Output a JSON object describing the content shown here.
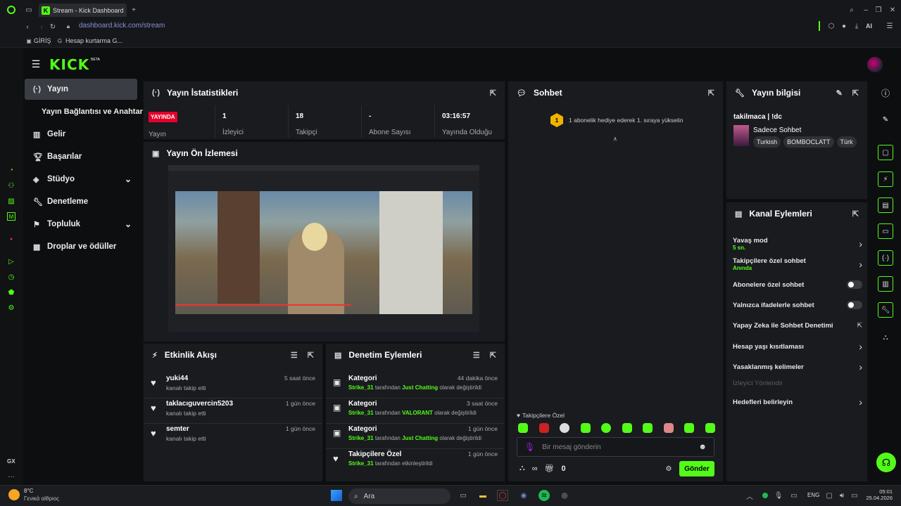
{
  "browser": {
    "tab_title": "Stream - Kick Dashboard",
    "url_host": "dashboard.kick.com",
    "url_path": "/stream",
    "ai_label": "AI",
    "bookmarks": [
      "GİRİŞ",
      "Hesap kurtarma G..."
    ]
  },
  "brand": {
    "logo": "KICK",
    "badge": "BETA",
    "accent": "#53fc18"
  },
  "nav": {
    "items": [
      {
        "label": "Yayın",
        "icon": "broadcast-icon"
      },
      {
        "label": "Yayın Bağlantısı ve Anahtarı",
        "icon": ""
      },
      {
        "label": "Gelir",
        "icon": "chart-icon"
      },
      {
        "label": "Başarılar",
        "icon": "trophy-icon"
      },
      {
        "label": "Stüdyo",
        "icon": "studio-icon"
      },
      {
        "label": "Denetleme",
        "icon": "wrench-icon"
      },
      {
        "label": "Topluluk",
        "icon": "community-icon"
      },
      {
        "label": "Droplar ve ödüller",
        "icon": "gift-icon"
      }
    ]
  },
  "stats": {
    "title": "Yayın İstatistikleri",
    "live_badge": "YAYINDA",
    "live_label": "Yayın",
    "items": [
      {
        "value": "1",
        "label": "İzleyici"
      },
      {
        "value": "18",
        "label": "Takipçi"
      },
      {
        "value": "-",
        "label": "Abone Sayısı"
      },
      {
        "value": "03:16:57",
        "label": "Yayında Olduğu"
      }
    ]
  },
  "preview": {
    "title": "Yayın Ön İzlemesi"
  },
  "activity": {
    "title": "Etkinlik Akışı",
    "items": [
      {
        "user": "yuki44",
        "desc": "kanalı takip etti",
        "time": "5 saat önce"
      },
      {
        "user": "taklacıguvercin5203",
        "desc": "kanalı takip etti",
        "time": "1 gün önce"
      },
      {
        "user": "semter",
        "desc": "kanalı takip etti",
        "time": "1 gün önce"
      }
    ]
  },
  "modlog": {
    "title": "Denetim Eylemleri",
    "items": [
      {
        "title": "Kategori",
        "time": "44 dakika önce",
        "who": "Strike_31",
        "mid": " tarafından ",
        "what": "Just Chatting",
        "end": " olarak değiştirildi"
      },
      {
        "title": "Kategori",
        "time": "3 saat önce",
        "who": "Strike_31",
        "mid": " tarafından ",
        "what": "VALORANT",
        "end": " olarak değiştirildi"
      },
      {
        "title": "Kategori",
        "time": "1 gün önce",
        "who": "Strike_31",
        "mid": " tarafından ",
        "what": "Just Chatting",
        "end": " olarak değiştirildi"
      },
      {
        "title": "Takipçilere Özel",
        "time": "1 gün önce",
        "who": "Strike_31",
        "mid": " tarafından etkinleştirildi",
        "what": "",
        "end": ""
      }
    ]
  },
  "chat": {
    "title": "Sohbet",
    "gift_num": "1",
    "gift_text": "1 abonelik hediye ederek 1. sıraya yükselin",
    "followers_only": "Takipçilere Özel",
    "placeholder": "Bir mesaj gönderin",
    "send": "Gönder",
    "count": "0"
  },
  "info": {
    "title": "Yayın bilgisi",
    "stream_title": "takilmaca | !dc",
    "category": "Sadece Sohbet",
    "tags": [
      "Turkish",
      "BOMBOCLATT",
      "Türk"
    ]
  },
  "channel": {
    "title": "Kanal Eylemleri",
    "items": [
      {
        "label": "Yavaş mod",
        "sub": "5 sn.",
        "ctl": "chevron"
      },
      {
        "label": "Takipçilere özel sohbet",
        "sub": "Anında",
        "ctl": "chevron"
      },
      {
        "label": "Abonelere özel sohbet",
        "sub": "",
        "ctl": "toggle"
      },
      {
        "label": "Yalnızca ifadelerle sohbet",
        "sub": "",
        "ctl": "toggle"
      },
      {
        "label": "Yapay Zeka ile Sohbet Denetimi",
        "sub": "",
        "ctl": "external"
      },
      {
        "label": "Hesap yaşı kısıtlaması",
        "sub": "",
        "ctl": "chevron"
      },
      {
        "label": "Yasaklanmış kelimeler",
        "sub": "",
        "ctl": "chevron"
      },
      {
        "label": "İzleyici Yönlendir",
        "sub": "",
        "ctl": "disabled"
      },
      {
        "label": "Hedefleri belirleyin",
        "sub": "",
        "ctl": "chevron"
      }
    ]
  },
  "taskbar": {
    "weather_temp": "8°C",
    "weather_desc": "Γενικά αίθριος",
    "search": "Ara",
    "lang": "ENG",
    "time": "05:01",
    "date": "25.04.2026"
  },
  "opera": {
    "gx": "GX"
  }
}
